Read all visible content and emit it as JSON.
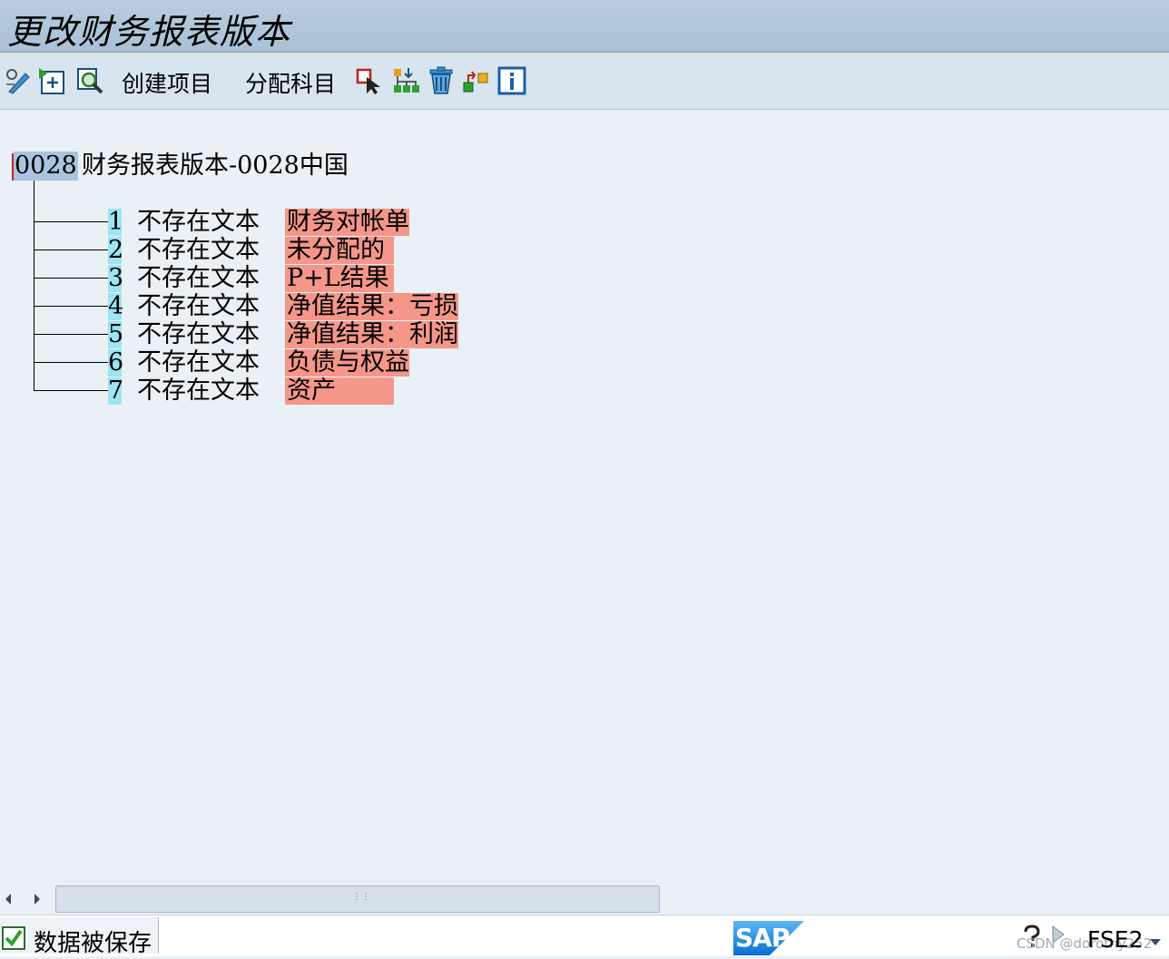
{
  "window": {
    "title": "更改财务报表版本"
  },
  "toolbar": {
    "icons": [
      "edit-icon",
      "new-item-icon",
      "search-icon",
      "select-icon",
      "hierarchy-icon",
      "delete-icon",
      "reassign-icon",
      "info-icon"
    ],
    "create_item_label": "创建项目",
    "assign_accounts_label": "分配科目"
  },
  "tree": {
    "root": {
      "code": "0028",
      "text": "财务报表版本-0028中国"
    },
    "items": [
      {
        "num": "1",
        "text": "不存在文本",
        "label": "财务对帐单"
      },
      {
        "num": "2",
        "text": "不存在文本",
        "label": "未分配的"
      },
      {
        "num": "3",
        "text": "不存在文本",
        "label": "P+L结果"
      },
      {
        "num": "4",
        "text": "不存在文本",
        "label": "净值结果：亏损"
      },
      {
        "num": "5",
        "text": "不存在文本",
        "label": "净值结果：利润"
      },
      {
        "num": "6",
        "text": "不存在文本",
        "label": "负债与权益"
      },
      {
        "num": "7",
        "text": "不存在文本",
        "label": "资产"
      }
    ]
  },
  "status": {
    "message": "数据被保存",
    "transaction": "FSE2",
    "brand": "SAP",
    "watermark": "CSDN @dorothy252"
  },
  "colors": {
    "background": "#e9f0f6",
    "number_highlight": "#9ee4f2",
    "label_highlight": "#f5968a",
    "selection": "#a9c4de"
  }
}
